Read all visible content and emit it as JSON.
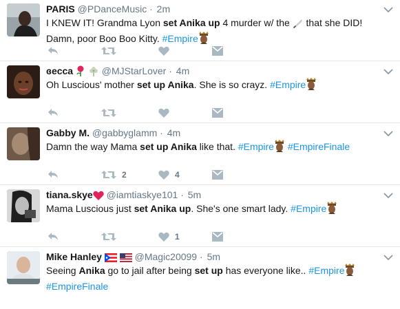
{
  "tweets": [
    {
      "name": "PARIS",
      "handle": "@PDanceMusic",
      "sep": "·",
      "time": "2m",
      "text_parts": [
        {
          "t": "I KNEW IT! Grandma Lyon "
        },
        {
          "t": "set Anika up",
          "b": true
        },
        {
          "t": " 4 murder w/ the "
        },
        {
          "icon": "knife-emoji"
        },
        {
          "t": " that she DID! Damn, poor Boo Boo Kitty. "
        },
        {
          "t": "#Empire",
          "tag": true
        },
        {
          "icon": "empire-emoji"
        }
      ],
      "retweets": "",
      "likes": ""
    },
    {
      "name": "ɞecca",
      "name_icons": [
        "rose-emoji",
        "flower-emoji"
      ],
      "handle": "@MJStarLover",
      "sep": "·",
      "time": "4m",
      "text_parts": [
        {
          "t": "Oh Luscious' mother "
        },
        {
          "t": "set up Anika",
          "b": true
        },
        {
          "t": ". She is so crayz. "
        },
        {
          "t": "#Empire",
          "tag": true
        },
        {
          "icon": "empire-emoji"
        }
      ],
      "retweets": "",
      "likes": ""
    },
    {
      "name": "Gabby M.",
      "handle": "@gabbyglamm",
      "sep": "·",
      "time": "4m",
      "text_parts": [
        {
          "t": "Damn the way Mama "
        },
        {
          "t": "set up Anika",
          "b": true
        },
        {
          "t": " like that. "
        },
        {
          "t": "#Empire",
          "tag": true
        },
        {
          "icon": "empire-emoji"
        },
        {
          "t": " "
        },
        {
          "t": "#EmpireFinale",
          "tag": true
        }
      ],
      "retweets": "2",
      "likes": "4"
    },
    {
      "name": "tiana.skye",
      "name_icons": [
        "red-heart-emoji"
      ],
      "handle": "@iamtiaskye101",
      "sep": "·",
      "time": "5m",
      "text_parts": [
        {
          "t": "Mama Luscious just "
        },
        {
          "t": "set Anika up",
          "b": true
        },
        {
          "t": ". She's one smart lady. "
        },
        {
          "t": "#Empire",
          "tag": true
        },
        {
          "icon": "empire-emoji"
        }
      ],
      "retweets": "",
      "likes": "1"
    },
    {
      "name": "Mike Hanley",
      "name_icons": [
        "puerto-rico-flag-emoji",
        "us-flag-emoji"
      ],
      "handle": "@Magic20099",
      "sep": "·",
      "time": "5m",
      "text_parts": [
        {
          "t": "Seeing "
        },
        {
          "t": "Anika",
          "b": true
        },
        {
          "t": " go to jail after being "
        },
        {
          "t": "set up",
          "b": true
        },
        {
          "t": " has everyone like.. "
        },
        {
          "t": "#Empire",
          "tag": true
        },
        {
          "icon": "empire-emoji"
        },
        {
          "t": " "
        },
        {
          "t": "#EmpireFinale",
          "tag": true
        }
      ],
      "retweets": "",
      "likes": ""
    }
  ],
  "colors": {
    "text": "#14171a",
    "muted": "#657786",
    "hashtag": "#1b95e0",
    "icon": "#aab8c2",
    "divider": "#e1e8ed"
  }
}
